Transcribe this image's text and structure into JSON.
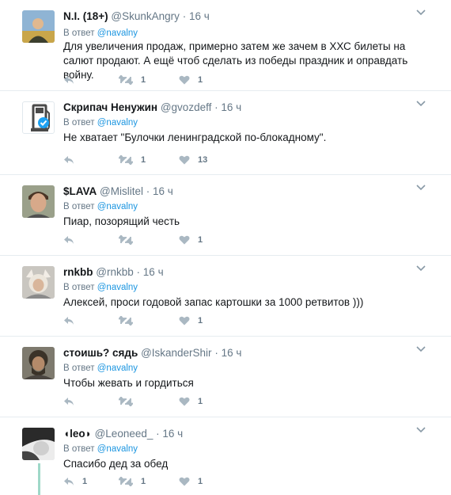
{
  "reply_prefix": "В ответ",
  "reply_handle": "@navalny",
  "dot": "·",
  "tweets": [
    {
      "fullname": "N.I. (18+)",
      "handle": "@SkunkAngry",
      "time": "16 ч",
      "text": "Для увеличения продаж, примерно затем же зачем в ХХС билеты на салют продают. А ещё чтоб сделать из победы праздник и оправдать войну.",
      "retweets": "1",
      "likes": "1",
      "replies": "",
      "show_reply_to": true
    },
    {
      "fullname": "Скрипач Ненужин",
      "handle": "@gvozdeff",
      "time": "16 ч",
      "text": "Не хватает \"Булочки ленинградской по-блокадному\".",
      "retweets": "1",
      "likes": "13",
      "replies": ""
    },
    {
      "fullname": "$LAVA",
      "handle": "@Mislitel",
      "time": "16 ч",
      "text": "Пиар, позорящий честь",
      "retweets": "",
      "likes": "1",
      "replies": ""
    },
    {
      "fullname": "rnkbb",
      "handle": "@rnkbb",
      "time": "16 ч",
      "text": "Алексей, проси годовой запас картошки за 1000 ретвитов )))",
      "retweets": "",
      "likes": "1",
      "replies": ""
    },
    {
      "fullname": "стоишь? сядь",
      "handle": "@IskanderShir",
      "time": "16 ч",
      "text": "Чтобы жевать и гордиться",
      "retweets": "",
      "likes": "1",
      "replies": ""
    },
    {
      "fullname": "◖leo◗",
      "handle": "@Leoneed_",
      "time": "16 ч",
      "text": "Спасибо дед за обед",
      "retweets": "1",
      "likes": "1",
      "replies": "1"
    }
  ]
}
